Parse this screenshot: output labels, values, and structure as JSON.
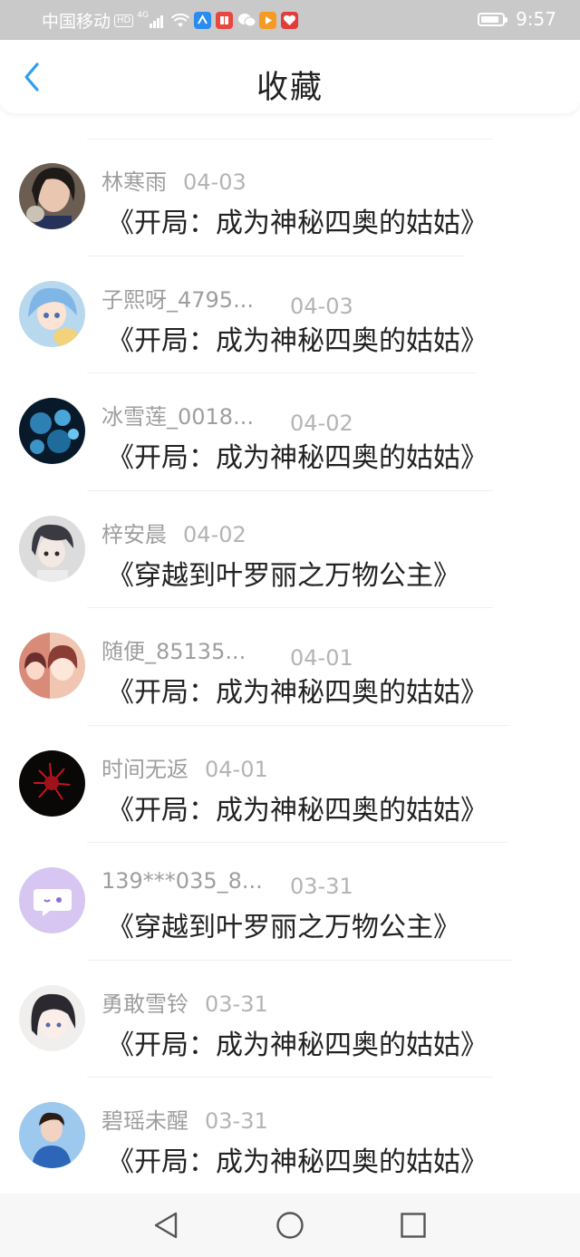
{
  "status_bar": {
    "carrier": "中国移动",
    "hd": "HD",
    "network": "4G",
    "time": "9:57",
    "battery_level": 0.85
  },
  "header": {
    "title": "收藏",
    "back_icon": "chevron-left-icon"
  },
  "items": [
    {
      "user": "林寒雨",
      "date": "04-03",
      "book": "《开局：成为神秘四奥的姑姑》",
      "avatar": "photo-girl"
    },
    {
      "user": "子熙呀_4795...",
      "date": "04-03",
      "book": "《开局：成为神秘四奥的姑姑》",
      "avatar": "anime-blue"
    },
    {
      "user": "冰雪莲_0018...",
      "date": "04-02",
      "book": "《开局：成为神秘四奥的姑姑》",
      "avatar": "blue-flowers"
    },
    {
      "user": "梓安晨",
      "date": "04-02",
      "book": "《穿越到叶罗丽之万物公主》",
      "avatar": "anime-boy"
    },
    {
      "user": "随便_85135...",
      "date": "04-01",
      "book": "《开局：成为神秘四奥的姑姑》",
      "avatar": "anime-red"
    },
    {
      "user": "时间无返",
      "date": "04-01",
      "book": "《开局：成为神秘四奥的姑姑》",
      "avatar": "red-flower"
    },
    {
      "user": "139***035_8...",
      "date": "03-31",
      "book": "《穿越到叶罗丽之万物公主》",
      "avatar": "default-chat"
    },
    {
      "user": "勇敢雪铃",
      "date": "03-31",
      "book": "《开局：成为神秘四奥的姑姑》",
      "avatar": "anime-dark-hair"
    },
    {
      "user": "碧瑶未醒",
      "date": "03-31",
      "book": "《开局：成为神秘四奥的姑姑》",
      "avatar": "photo-boy"
    }
  ],
  "nav": {
    "back": "triangle-back-icon",
    "home": "circle-home-icon",
    "recent": "square-recent-icon"
  }
}
